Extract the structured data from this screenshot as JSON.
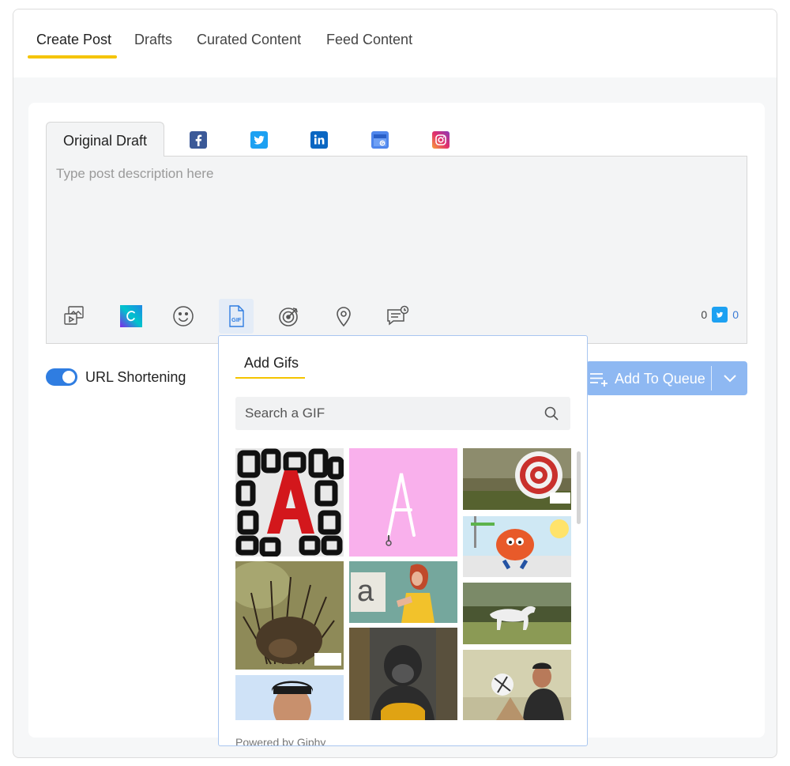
{
  "tabs": [
    "Create Post",
    "Drafts",
    "Curated Content",
    "Feed Content"
  ],
  "composer": {
    "draft_tab": "Original Draft",
    "networks": [
      "facebook-icon",
      "twitter-icon",
      "linkedin-icon",
      "google-business-icon",
      "instagram-icon"
    ],
    "placeholder": "Type post description here",
    "tools": [
      "media-icon",
      "canva-icon",
      "emoji-icon",
      "gif-icon",
      "target-icon",
      "location-icon",
      "comment-icon"
    ],
    "char_count": "0",
    "twitter_count": "0"
  },
  "options": {
    "url_shortening_label": "URL Shortening",
    "url_shortening_on": true
  },
  "queue_button": {
    "label": "Add To Queue"
  },
  "gif_panel": {
    "title": "Add Gifs",
    "search_placeholder": "Search a GIF",
    "footer": "Powered by Giphy"
  },
  "colors": {
    "accent_yellow": "#f5c400",
    "primary_blue": "#2f7de1",
    "queue_button": "#8eb8f2",
    "facebook": "#3b5998",
    "twitter": "#1da1f2",
    "linkedin": "#0a66c2",
    "instagram": "#e1306c"
  }
}
